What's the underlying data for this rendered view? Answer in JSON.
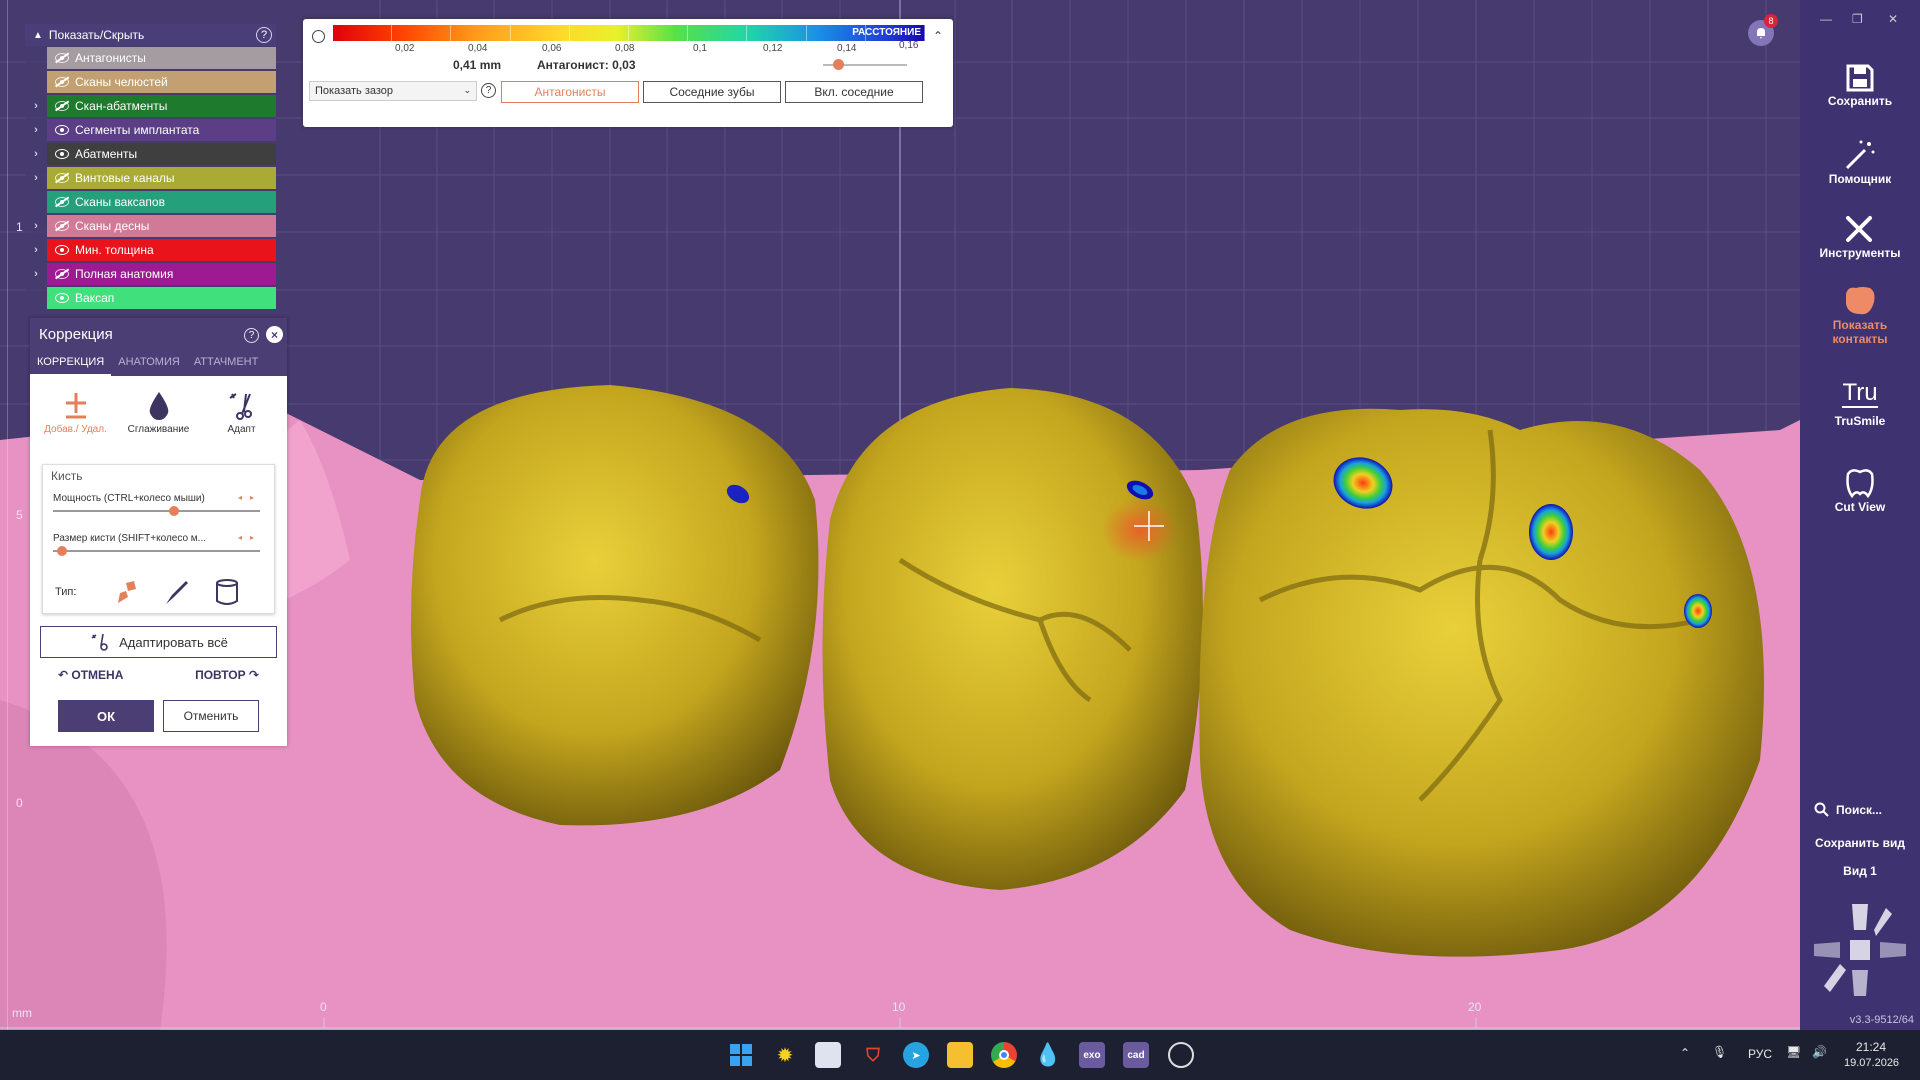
{
  "layers_panel": {
    "title": "Показать/Скрыть",
    "items": [
      {
        "label": "Антагонисты",
        "color": "#a49ca0",
        "visible": false,
        "expandable": false
      },
      {
        "label": "Сканы челюстей",
        "color": "#c3a071",
        "visible": false,
        "expandable": false
      },
      {
        "label": "Скан-абатменты",
        "color": "#1e7a2c",
        "visible": false,
        "expandable": true
      },
      {
        "label": "Сегменты имплантата",
        "color": "#5b3e86",
        "visible": true,
        "expandable": true
      },
      {
        "label": "Абатменты",
        "color": "#3f3f3f",
        "visible": true,
        "expandable": true
      },
      {
        "label": "Винтовые каналы",
        "color": "#a9ab34",
        "visible": false,
        "expandable": true
      },
      {
        "label": "Сканы ваксапов",
        "color": "#24a07a",
        "visible": false,
        "expandable": false
      },
      {
        "label": "Сканы десны",
        "color": "#d17a98",
        "visible": false,
        "expandable": true
      },
      {
        "label": "Мин. толщина",
        "color": "#e8131b",
        "visible": true,
        "expandable": true
      },
      {
        "label": "Полная анатомия",
        "color": "#9d1a93",
        "visible": false,
        "expandable": true
      },
      {
        "label": "Ваксап",
        "color": "#40e07c",
        "visible": true,
        "expandable": false
      }
    ]
  },
  "correction": {
    "title": "Коррекция",
    "tabs": [
      "КОРРЕКЦИЯ",
      "АНАТОМИЯ",
      "АТТАЧМЕНТ"
    ],
    "tools": [
      {
        "label": "Добав./ Удал.",
        "icon": "add-remove-icon"
      },
      {
        "label": "Сглаживание",
        "icon": "drop-icon"
      },
      {
        "label": "Адапт",
        "icon": "adapt-icon"
      }
    ],
    "brush_title": "Кисть",
    "power_label": "Мощность (CTRL+колесо мыши)",
    "power_value": 0.58,
    "size_label": "Размер кисти (SHIFT+колесо м...",
    "size_value": 0.02,
    "type_label": "Тип:",
    "adapt_all": "Адаптировать всё",
    "undo": "ОТМЕНА",
    "redo": "ПОВТОР",
    "ok": "ОК",
    "cancel": "Отменить"
  },
  "gap_panel": {
    "scale_title": "РАССТОЯНИЕ",
    "scale_values": [
      "0,02",
      "0,04",
      "0,06",
      "0,08",
      "0,1",
      "0,12",
      "0,14",
      "0,16"
    ],
    "distance": "0,41 mm",
    "antagonist": "Антагонист: 0,03",
    "select_value": "Показать зазор",
    "btn_antagonists": "Антагонисты",
    "btn_neighbors": "Соседние зубы",
    "btn_include_neighbors": "Вкл. соседние",
    "accent": "#e3805a",
    "slider_value": 0.12
  },
  "ruler": {
    "bottom": [
      "0",
      "10",
      "20"
    ],
    "left": [
      "1",
      "5",
      "0"
    ],
    "unit": "mm"
  },
  "notification_count": "8",
  "sidebar": {
    "items": [
      {
        "label": "Сохранить",
        "icon": "save-icon"
      },
      {
        "label": "Помощник",
        "icon": "wand-icon"
      },
      {
        "label": "Инструменты",
        "icon": "tools-icon"
      },
      {
        "label": "Показать контакты",
        "icon": "contacts-icon"
      },
      {
        "label": "TruSmile",
        "icon": "trusmile-icon",
        "mark": "Tru"
      },
      {
        "label": "Cut View",
        "icon": "cutview-icon"
      }
    ],
    "search": "Поиск...",
    "save_view": "Сохранить вид",
    "view": "Вид 1",
    "version": "v3.3-9512/64"
  },
  "taskbar": {
    "lang": "РУС",
    "time": "21:24",
    "date": "19.07.2026",
    "apps": [
      "windows-start-icon",
      "sun-app-icon",
      "scanner-app-icon",
      "shield-app-icon",
      "telegram-icon",
      "folder-icon",
      "chrome-icon",
      "drop-app-icon",
      "exo-app-icon",
      "cad-app-icon",
      "obs-icon"
    ],
    "exo_label": "exo",
    "cad_label": "cad"
  }
}
